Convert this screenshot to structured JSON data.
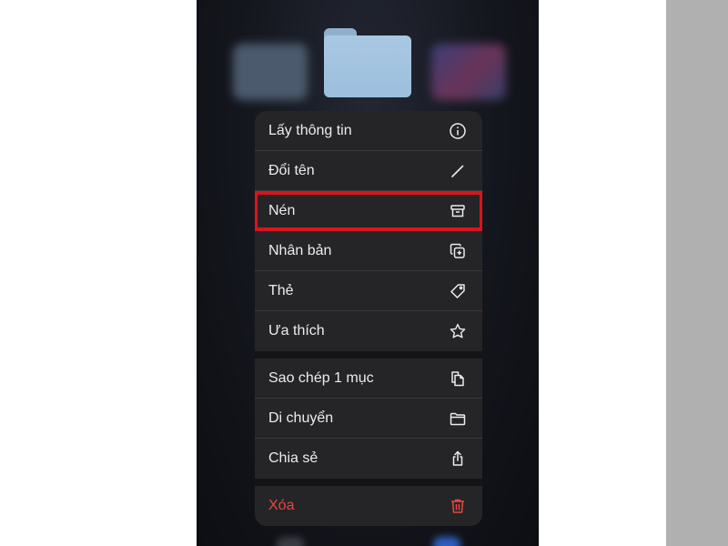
{
  "menu": {
    "items": [
      {
        "label": "Lấy thông tin",
        "icon": "info-icon"
      },
      {
        "label": "Đổi tên",
        "icon": "pencil-icon"
      },
      {
        "label": "Nén",
        "icon": "archive-box-icon"
      },
      {
        "label": "Nhân bản",
        "icon": "duplicate-icon"
      },
      {
        "label": "Thẻ",
        "icon": "tag-icon"
      },
      {
        "label": "Ưa thích",
        "icon": "star-icon"
      },
      {
        "label": "Sao chép 1 mục",
        "icon": "copy-document-icon"
      },
      {
        "label": "Di chuyển",
        "icon": "folder-icon"
      },
      {
        "label": "Chia sẻ",
        "icon": "share-icon"
      },
      {
        "label": "Xóa",
        "icon": "trash-icon"
      }
    ]
  },
  "colors": {
    "menu_background": "#252527",
    "highlight": "#d9141d",
    "destructive": "#e8483f",
    "folder": "#9cbfdd"
  }
}
